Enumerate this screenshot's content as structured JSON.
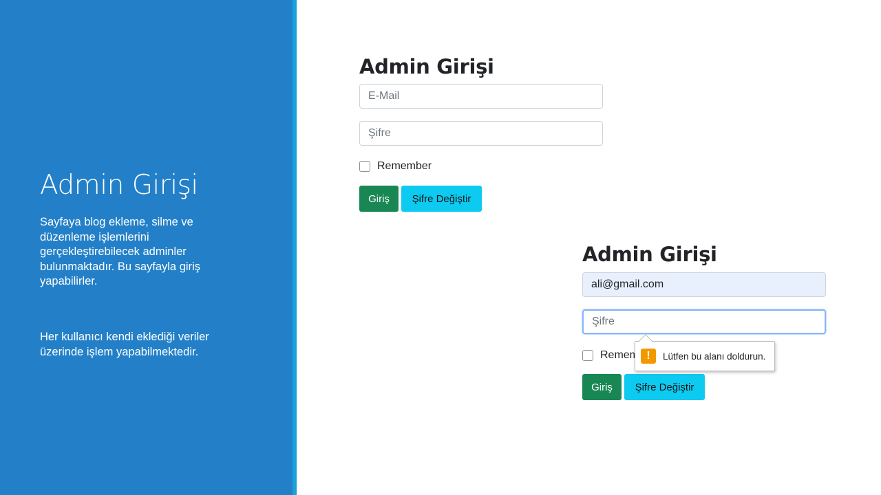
{
  "slide": {
    "title": "Admin Girişi",
    "paragraph1": "Sayfaya blog ekleme, silme ve düzenleme işlemlerini gerçekleştirebilecek adminler bulunmaktadır. Bu sayfayla giriş yapabilirler.",
    "paragraph2": "Her kullanıcı kendi eklediği veriler üzerinde işlem yapabilmektedir."
  },
  "colors": {
    "panel": "#2380c8",
    "stripe": "#1aa0dc",
    "login_button": "#198754",
    "change_button": "#0dcaf0",
    "warning": "#f29900"
  },
  "form_empty": {
    "heading": "Admin Girişi",
    "email_placeholder": "E-Mail",
    "password_placeholder": "Şifre",
    "remember_label": "Remember",
    "login_label": "Giriş",
    "change_password_label": "Şifre Değiştir"
  },
  "form_validation": {
    "heading": "Admin Girişi",
    "email_value": "ali@gmail.com",
    "password_placeholder": "Şifre",
    "remember_label": "Remem",
    "login_label": "Giriş",
    "change_password_label": "Şifre Değiştir",
    "tooltip_icon": "warning-icon",
    "tooltip_text": "Lütfen bu alanı doldurun."
  }
}
